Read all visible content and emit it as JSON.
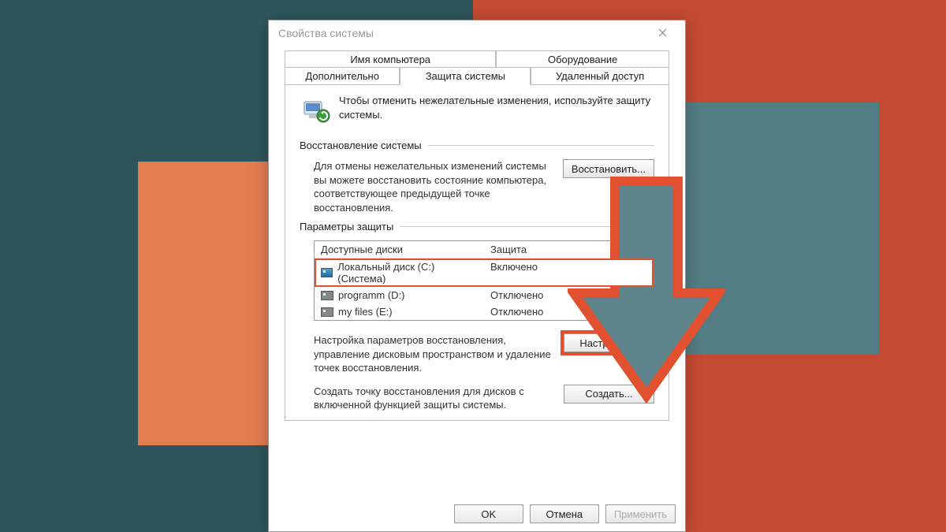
{
  "dialog": {
    "title": "Свойства системы",
    "tabs_top": [
      {
        "label": "Имя компьютера"
      },
      {
        "label": "Оборудование"
      }
    ],
    "tabs_bottom": [
      {
        "label": "Дополнительно"
      },
      {
        "label": "Защита системы",
        "active": true
      },
      {
        "label": "Удаленный доступ"
      }
    ],
    "intro": "Чтобы отменить нежелательные изменения, используйте защиту системы.",
    "group_restore": "Восстановление системы",
    "restore_text": "Для отмены нежелательных изменений системы вы можете восстановить состояние компьютера, соответствующее предыдущей точке восстановления.",
    "restore_button": "Восстановить...",
    "group_params": "Параметры защиты",
    "table": {
      "head_col1": "Доступные диски",
      "head_col2": "Защита",
      "rows": [
        {
          "name": "Локальный диск (C:) (Система)",
          "status": "Включено",
          "highlight": true,
          "sys": true
        },
        {
          "name": "programm (D:)",
          "status": "Отключено"
        },
        {
          "name": "my files (E:)",
          "status": "Отключено"
        }
      ]
    },
    "configure_text": "Настройка параметров восстановления, управление дисковым пространством и удаление точек восстановления.",
    "configure_button": "Настроить...",
    "create_text": "Создать точку восстановления для дисков с включенной функцией защиты системы.",
    "create_button": "Создать...",
    "footer": {
      "ok": "OK",
      "cancel": "Отмена",
      "apply": "Применить"
    }
  }
}
